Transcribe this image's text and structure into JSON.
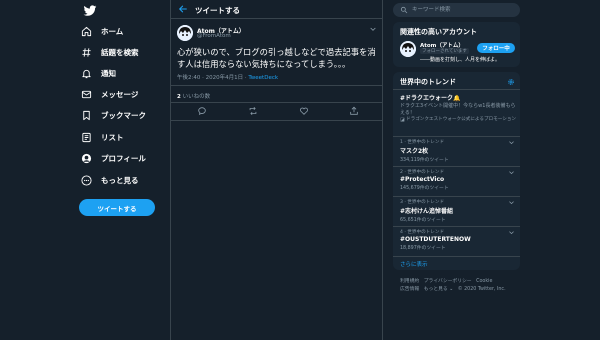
{
  "nav": {
    "items": [
      {
        "icon": "home-icon",
        "label": "ホーム"
      },
      {
        "icon": "hashtag-icon",
        "label": "話題を検索"
      },
      {
        "icon": "bell-icon",
        "label": "通知"
      },
      {
        "icon": "mail-icon",
        "label": "メッセージ"
      },
      {
        "icon": "bookmark-icon",
        "label": "ブックマーク"
      },
      {
        "icon": "list-icon",
        "label": "リスト"
      },
      {
        "icon": "profile-icon",
        "label": "プロフィール"
      },
      {
        "icon": "more-icon",
        "label": "もっと見る"
      }
    ],
    "tweet_button": "ツイートする"
  },
  "header": {
    "title": "ツイートする"
  },
  "tweet": {
    "author_name": "Atom（アトム）",
    "author_handle": "@FromAtom",
    "text": "心が狭いので、ブログの引っ越しなどで過去記事を消す人は信用ならない気持ちになってしまう。。。",
    "time": "午後2:40 · 2020年4月1日 · ",
    "source": "TweetDeck",
    "like_count": "2",
    "like_label": " いいねの数"
  },
  "search": {
    "placeholder": "キーワード検索"
  },
  "related": {
    "title": "関連性の高いアカウント",
    "name": "Atom（アトム）",
    "follows_you": "フォローされています",
    "bio": "――動画を打刻し、人月を伸ばよ。",
    "follow_label": "フォロー中"
  },
  "trends": {
    "title": "世界中のトレンド",
    "promo": {
      "title": "#ドラクエウォーク🔔",
      "desc": "ドラクエ3イベント開催中！今ならw1長者装備もらえる！",
      "foot": "ドラゴンクエストウォーク公式によるプロモーション"
    },
    "items": [
      {
        "category": "1 · 世界中のトレンド",
        "name": "マスク2枚",
        "count": "334,119件のツイート"
      },
      {
        "category": "2 · 世界中のトレンド",
        "name": "#ProtectVico",
        "count": "145,679件のツイート"
      },
      {
        "category": "3 · 世界中のトレンド",
        "name": "#志村けん追悼番組",
        "count": "65,651件のツイート"
      },
      {
        "category": "4 · 世界中のトレンド",
        "name": "#OUSTDUTERTENOW",
        "count": "18,897件のツイート"
      }
    ],
    "more": "さらに表示"
  },
  "footer": {
    "links": [
      "利用規約",
      "プライバシーポリシー",
      "Cookie",
      "広告情報",
      "もっと見る ⌄",
      "© 2020 Twitter, Inc."
    ]
  },
  "colors": {
    "background": "#15202b",
    "accent": "#1da1f2",
    "card": "#192734",
    "muted": "#8899a6",
    "border": "#38444d"
  }
}
